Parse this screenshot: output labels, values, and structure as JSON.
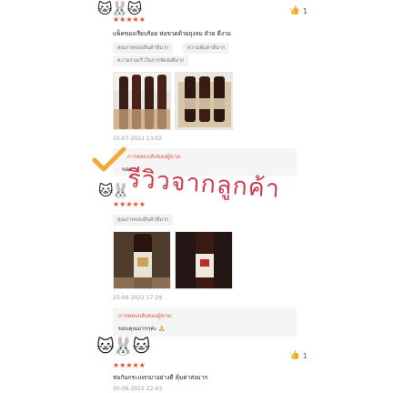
{
  "reviews": [
    {
      "stars": "★★★★★",
      "likes": "1",
      "more": "···",
      "comment": "แพ็คของเรียบร้อย ห่อขวดด้วยถุงลม ด้วย ดีงาม",
      "tags": [
        "คุณภาพของสินค้าดีมาก",
        "ความคุ้มค่าดีมาก",
        "ความรวดเร็วในการจัดส่งดีมาก"
      ],
      "date": "10-07-2022 13:02",
      "reply_title": "การตอบกลับของผู้ขาย:",
      "reply_body": "ขอบ"
    },
    {
      "stars": "★★★★★",
      "tags": [
        "คุณภาพของสินค้าดีมาก"
      ],
      "date": "25-06-2022 17:29",
      "reply_title": "การตอบกลับของผู้ขาย:",
      "reply_body": "ขอบคุณมากๆค่ะ 🙏"
    },
    {
      "stars": "★★★★★",
      "likes": "1",
      "more": "···",
      "comment": "ห่อกันกระแทกมาอย่างดี คุ้มค่าส่งมาก",
      "date": "30-06-2022 22:43"
    }
  ],
  "overlay_title": "รีวิวจากลูกค้า",
  "colors": {
    "accent": "#ee4d2d",
    "overlay": "#cf3d4d",
    "check": "#f0a93a"
  },
  "icons": {
    "like": "thumbs-up-icon",
    "more": "more-dots-icon",
    "check": "check-mark-icon",
    "avatar": "cartoon-cats-sticker"
  }
}
